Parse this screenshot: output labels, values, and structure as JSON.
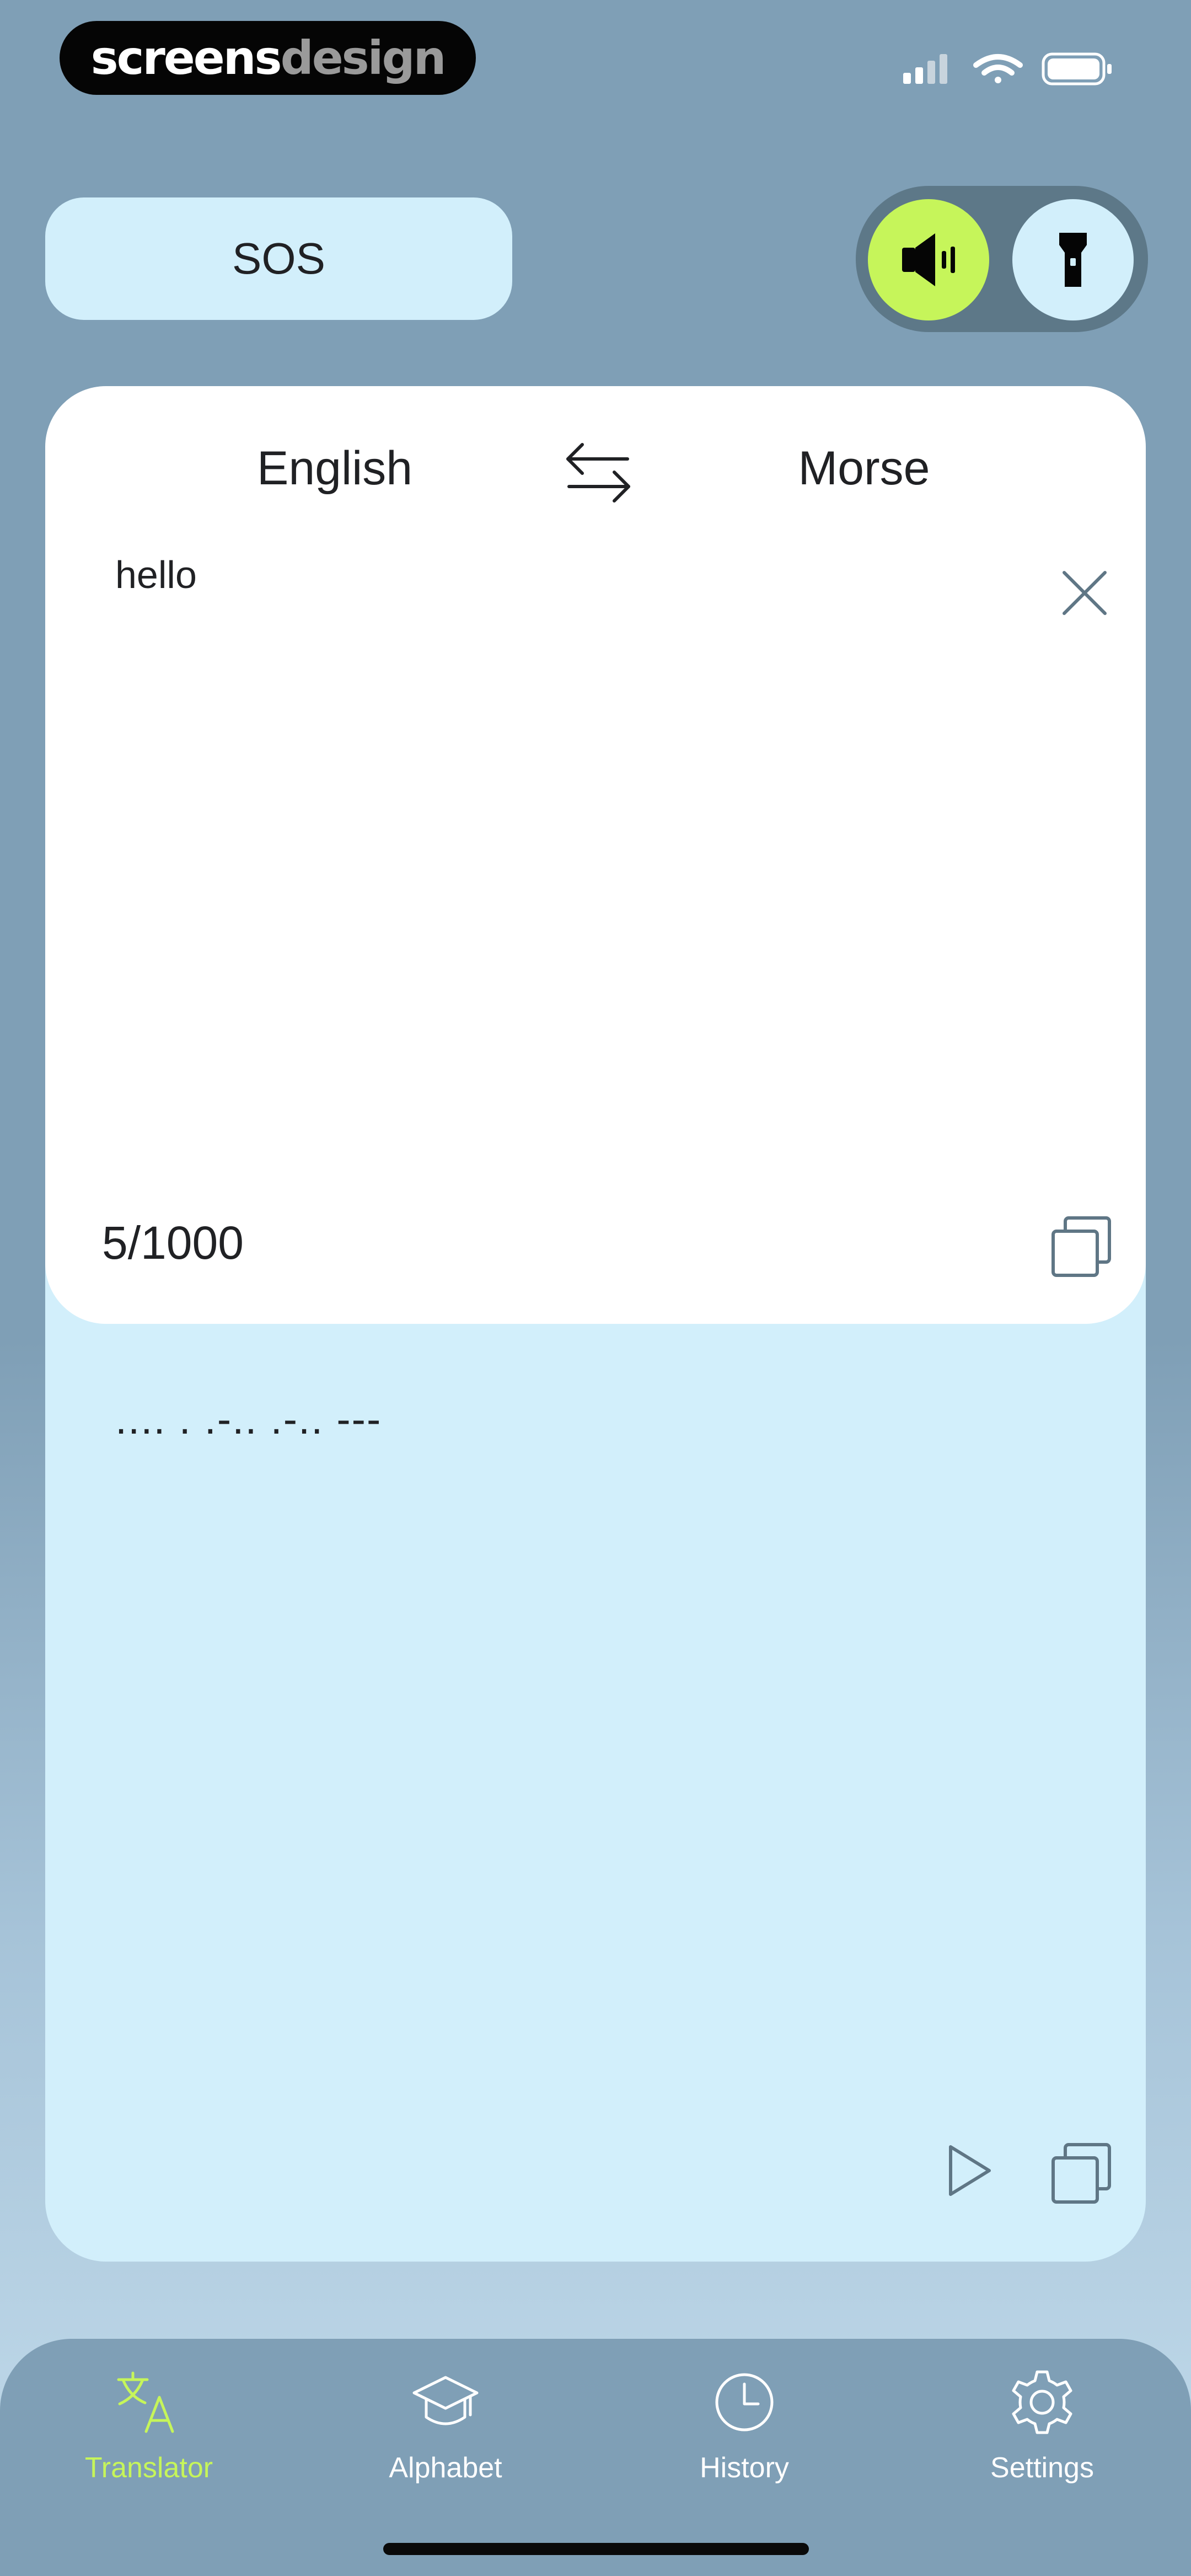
{
  "status_bar": {
    "brand_part1": "screens",
    "brand_part2": "design"
  },
  "header": {
    "sos_label": "SOS",
    "modes": [
      {
        "name": "sound",
        "icon": "speaker-icon",
        "active": true
      },
      {
        "name": "flashlight",
        "icon": "flashlight-icon",
        "active": false
      }
    ]
  },
  "translator": {
    "source_language": "English",
    "target_language": "Morse",
    "input_text": "hello",
    "char_count": "5/1000",
    "output_text": ".... . .-.. .-.. ---"
  },
  "tab_bar": {
    "tabs": [
      {
        "label": "Translator",
        "icon": "translate-icon",
        "active": true
      },
      {
        "label": "Alphabet",
        "icon": "graduation-cap-icon",
        "active": false
      },
      {
        "label": "History",
        "icon": "clock-icon",
        "active": false
      },
      {
        "label": "Settings",
        "icon": "gear-icon",
        "active": false
      }
    ]
  },
  "colors": {
    "background": "#7f9fb6",
    "accent": "#c6f55a",
    "panel": "#d2effb",
    "card": "#ffffff"
  }
}
